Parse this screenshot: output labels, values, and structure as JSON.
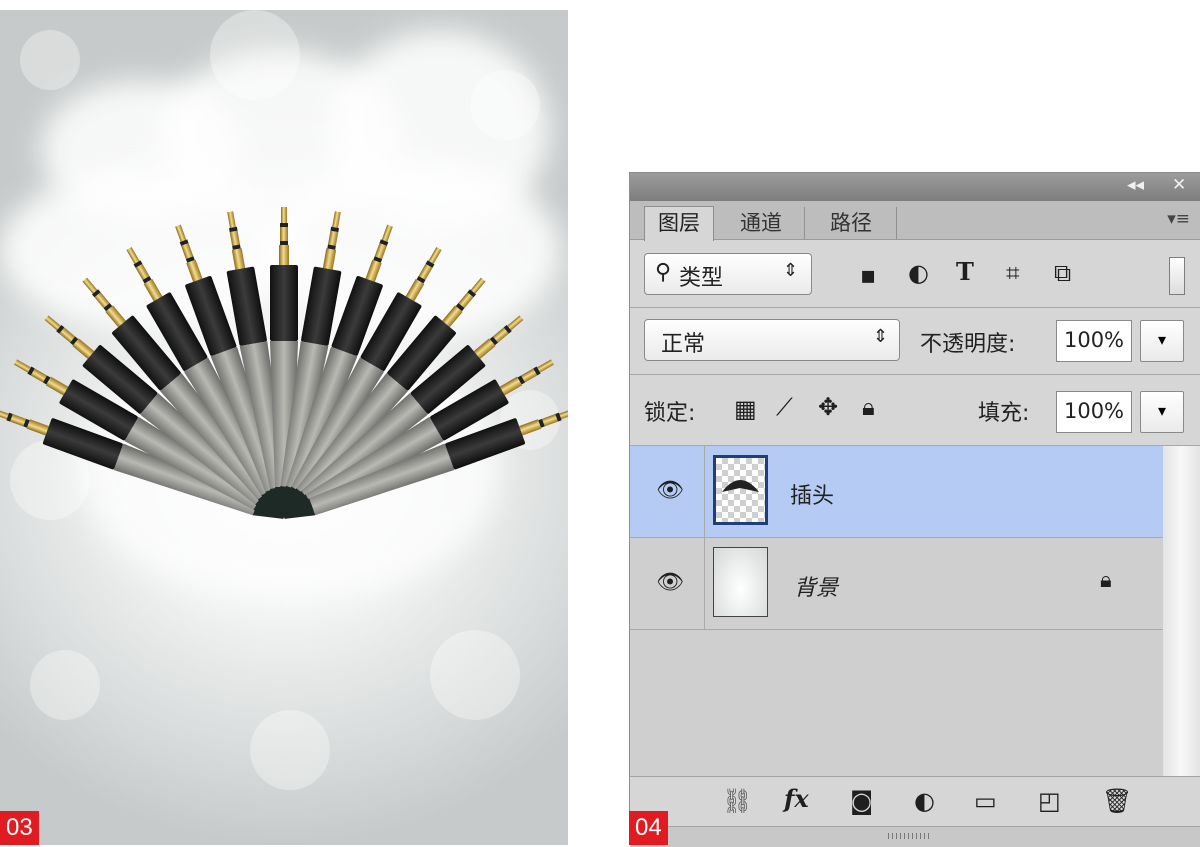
{
  "figure_left": {
    "label": "03"
  },
  "figure_right": {
    "label": "04"
  },
  "panel": {
    "title_controls": {
      "collapse": "◂◂",
      "close": "✕"
    },
    "tabs": [
      {
        "label": "图层",
        "active": true
      },
      {
        "label": "通道",
        "active": false
      },
      {
        "label": "路径",
        "active": false
      }
    ],
    "menu_icon": "panel-menu-icon",
    "filter": {
      "search_icon": "⚲",
      "kind_label": "类型",
      "stepper": "⇕"
    },
    "blend": {
      "mode": "正常",
      "stepper": "⇕",
      "opacity_label": "不透明度:",
      "opacity_value": "100%",
      "dropdown": "▾"
    },
    "lock": {
      "label": "锁定:",
      "fill_label": "填充:",
      "fill_value": "100%",
      "dropdown": "▾"
    },
    "layers": [
      {
        "name": "插头",
        "selected": true,
        "visible": true,
        "locked": false
      },
      {
        "name": "背景",
        "selected": false,
        "visible": true,
        "locked": true
      }
    ],
    "colors": {
      "selection": "#b6cbf4",
      "label_red": "#e11b22"
    }
  }
}
